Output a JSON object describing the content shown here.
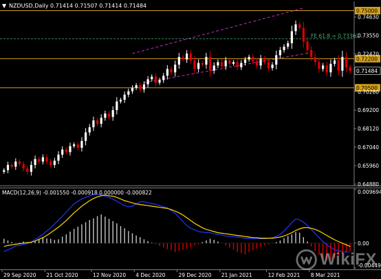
{
  "header": {
    "arrow": "▼",
    "title": "NZDUSD,Daily  0.71414 0.71507 0.71414 0.71484"
  },
  "macd_header": {
    "title": "MACD(12,26,9) -0.001550 -0.000918 0.000000 -0.000822"
  },
  "fe_label": "FE 61.8 = 0.73362",
  "watermark": {
    "brand": "WikiFX",
    "icon": "wikifx-logo-icon"
  },
  "colors": {
    "background": "#000000",
    "bull": "#ffffff",
    "bear": "#e00000",
    "level_line": "#d4a017",
    "fe_line": "#2e8b57",
    "fe_text": "#3cb371",
    "channel": "#c030c0",
    "macd_line": "#2233ff",
    "signal_line": "#ffd700",
    "hist_pos": "#c8c8c8",
    "hist_neg": "#dd0000"
  },
  "chart_data": [
    {
      "type": "candlestick",
      "symbol": "NZDUSD",
      "timeframe": "Daily",
      "ohlc_last": {
        "open": 0.71414,
        "high": 0.71507,
        "low": 0.71414,
        "close": 0.71484
      },
      "price_ticks": [
        "0.74630",
        "0.73550",
        "0.72470",
        "0.71480",
        "0.70280",
        "0.69200",
        "0.68120",
        "0.67040",
        "0.65960",
        "0.64880"
      ],
      "ylim": [
        0.6488,
        0.753
      ],
      "x_labels": [
        "29 Sep 2020",
        "21 Oct 2020",
        "12 Nov 2020",
        "4 Dec 2020",
        "29 Dec 2020",
        "21 Jan 2021",
        "12 Feb 2021",
        "8 Mar 2021"
      ],
      "levels": [
        {
          "label": "0.75000",
          "value": 0.75
        },
        {
          "label": "0.72200",
          "value": 0.722
        },
        {
          "label": "0.70500",
          "value": 0.705
        }
      ],
      "fibonacci": {
        "label": "FE 61.8 = 0.73362",
        "value": 0.73362
      },
      "current_price": {
        "label": "0.71484",
        "value": 0.71484
      },
      "channel": {
        "upper": [
          {
            "bar": 33,
            "price": 0.725
          },
          {
            "bar": 77,
            "price": 0.7515
          }
        ],
        "lower": [
          {
            "bar": 36,
            "price": 0.708
          },
          {
            "bar": 80,
            "price": 0.726
          }
        ]
      },
      "closes": [
        0.657,
        0.66,
        0.659,
        0.662,
        0.6605,
        0.658,
        0.656,
        0.66,
        0.6635,
        0.662,
        0.6645,
        0.662,
        0.66,
        0.6625,
        0.666,
        0.669,
        0.6675,
        0.671,
        0.672,
        0.67,
        0.674,
        0.679,
        0.682,
        0.686,
        0.684,
        0.6875,
        0.69,
        0.688,
        0.692,
        0.697,
        0.698,
        0.701,
        0.703,
        0.705,
        0.7065,
        0.704,
        0.707,
        0.71,
        0.7115,
        0.708,
        0.7095,
        0.712,
        0.716,
        0.714,
        0.7185,
        0.723,
        0.7215,
        0.725,
        0.721,
        0.716,
        0.7195,
        0.7185,
        0.723,
        0.715,
        0.718,
        0.72,
        0.7175,
        0.721,
        0.719,
        0.72,
        0.717,
        0.7195,
        0.7215,
        0.723,
        0.7205,
        0.718,
        0.722,
        0.72,
        0.7165,
        0.7185,
        0.724,
        0.727,
        0.729,
        0.731,
        0.738,
        0.742,
        0.74,
        0.732,
        0.727,
        0.723,
        0.72,
        0.716,
        0.718,
        0.714,
        0.719,
        0.721,
        0.715,
        0.723,
        0.717,
        0.7148
      ]
    },
    {
      "type": "macd",
      "title": "MACD(12,26,9)",
      "params": [
        12,
        26,
        9
      ],
      "values_header": [
        -0.00155,
        -0.000918,
        0.0,
        -0.000822
      ],
      "ticks": [
        "0.009694",
        "0.00",
        "-0.004498"
      ],
      "ylim": [
        -0.004498,
        0.009694
      ],
      "histogram": [
        0.0008,
        0.0005,
        0.0002,
        -0.0001,
        0.0001,
        0.0003,
        0.0002,
        0.0001,
        0.0004,
        0.0007,
        0.0011,
        0.0009,
        0.0008,
        0.0006,
        0.0007,
        0.0012,
        0.0016,
        0.0021,
        0.0026,
        0.003,
        0.0034,
        0.0038,
        0.0042,
        0.0045,
        0.0049,
        0.0052,
        0.0048,
        0.0044,
        0.004,
        0.0036,
        0.0031,
        0.0027,
        0.0022,
        0.0018,
        0.0014,
        0.0011,
        0.0007,
        0.0004,
        0.0001,
        -0.0002,
        -0.0005,
        -0.0008,
        -0.0011,
        -0.0013,
        -0.0016,
        -0.0014,
        -0.0012,
        -0.001,
        -0.0007,
        -0.0004,
        -0.0002,
        0.0002,
        0.0005,
        0.0008,
        0.0006,
        0.0003,
        0.0,
        -0.0004,
        -0.0008,
        -0.0012,
        -0.0016,
        -0.0018,
        -0.002,
        -0.0016,
        -0.0013,
        -0.001,
        -0.0007,
        -0.0004,
        -0.0002,
        -0.0001,
        0.0002,
        0.0005,
        0.0009,
        0.0013,
        0.0016,
        0.002,
        0.0019,
        0.0011,
        0.0003,
        -0.0006,
        -0.0014,
        -0.0021,
        -0.0027,
        -0.0031,
        -0.0029,
        -0.0026,
        -0.0022,
        -0.0019,
        -0.0016,
        -0.0014
      ],
      "macd_line": [
        -0.0015,
        -0.0012,
        -0.0009,
        -0.0005,
        -0.0004,
        -0.0002,
        -0.0001,
        0.0002,
        0.0007,
        0.0011,
        0.0016,
        0.0022,
        0.0028,
        0.0035,
        0.0042,
        0.0049,
        0.0056,
        0.0064,
        0.0071,
        0.0076,
        0.008,
        0.0083,
        0.0086,
        0.0088,
        0.0089,
        0.0087,
        0.0085,
        0.0083,
        0.008,
        0.0076,
        0.0072,
        0.0068,
        0.0066,
        0.0067,
        0.0071,
        0.0075,
        0.0075,
        0.0073,
        0.0072,
        0.007,
        0.0068,
        0.0066,
        0.0064,
        0.0059,
        0.0054,
        0.0047,
        0.0039,
        0.0032,
        0.0027,
        0.0024,
        0.0021,
        0.002,
        0.0019,
        0.0019,
        0.0017,
        0.0016,
        0.0015,
        0.0013,
        0.0012,
        0.0012,
        0.0011,
        0.001,
        0.0009,
        0.0009,
        0.0008,
        0.0008,
        0.0008,
        0.0008,
        0.0009,
        0.001,
        0.0012,
        0.0016,
        0.0022,
        0.003,
        0.0037,
        0.0044,
        0.0042,
        0.0038,
        0.0032,
        0.0025,
        0.0017,
        0.001,
        0.0003,
        -0.0003,
        -0.0008,
        -0.0012,
        -0.0014,
        -0.0015,
        -0.0016,
        -0.0016
      ],
      "signal_line": [
        -0.0006,
        -0.0004,
        -0.0003,
        -0.0002,
        -0.0001,
        0.0,
        0.0001,
        0.0002,
        0.0004,
        0.0007,
        0.001,
        0.0014,
        0.0019,
        0.0024,
        0.0029,
        0.0035,
        0.0041,
        0.0048,
        0.0055,
        0.0061,
        0.0067,
        0.0072,
        0.0077,
        0.0081,
        0.0084,
        0.0086,
        0.0087,
        0.0086,
        0.0085,
        0.0083,
        0.008,
        0.0077,
        0.0075,
        0.0073,
        0.0071,
        0.007,
        0.0069,
        0.0068,
        0.0067,
        0.0066,
        0.0065,
        0.0064,
        0.0063,
        0.0061,
        0.0058,
        0.0055,
        0.0051,
        0.0046,
        0.0041,
        0.0036,
        0.0032,
        0.0028,
        0.0025,
        0.0023,
        0.0021,
        0.0019,
        0.0018,
        0.0017,
        0.0016,
        0.0015,
        0.0014,
        0.0013,
        0.0012,
        0.0011,
        0.001,
        0.001,
        0.0009,
        0.0009,
        0.0009,
        0.0009,
        0.001,
        0.0011,
        0.0013,
        0.0016,
        0.0019,
        0.0023,
        0.0026,
        0.0028,
        0.0028,
        0.0027,
        0.0025,
        0.0022,
        0.0018,
        0.0014,
        0.001,
        0.0006,
        0.0003,
        0.0,
        -0.0003,
        -0.0006
      ]
    }
  ]
}
